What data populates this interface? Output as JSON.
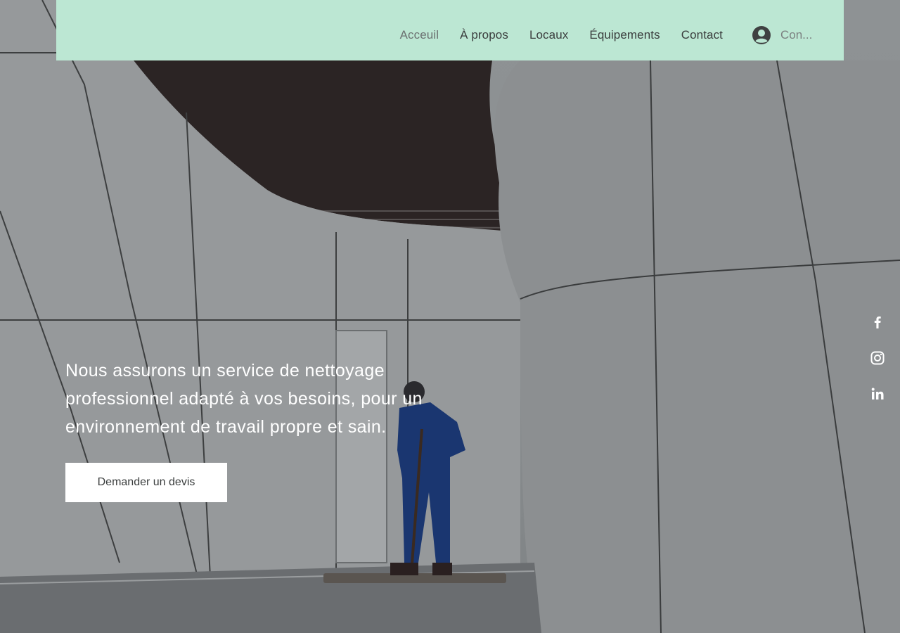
{
  "header": {
    "background": "#bce7d3",
    "nav": [
      {
        "label": "Acceuil",
        "active": true
      },
      {
        "label": "À propos",
        "active": false
      },
      {
        "label": "Locaux",
        "active": false
      },
      {
        "label": "Équipements",
        "active": false
      },
      {
        "label": "Contact",
        "active": false
      }
    ],
    "login": {
      "label": "Con...",
      "icon": "user-avatar-icon"
    }
  },
  "hero": {
    "headline": "Nous assurons un service de nettoyage professionnel adapté à vos besoins, pour un environnement de travail propre et sain.",
    "cta_label": "Demander un devis",
    "image": "cleaner-mopping-modern-corridor"
  },
  "social": [
    {
      "name": "facebook-icon"
    },
    {
      "name": "instagram-icon"
    },
    {
      "name": "linkedin-icon"
    }
  ]
}
